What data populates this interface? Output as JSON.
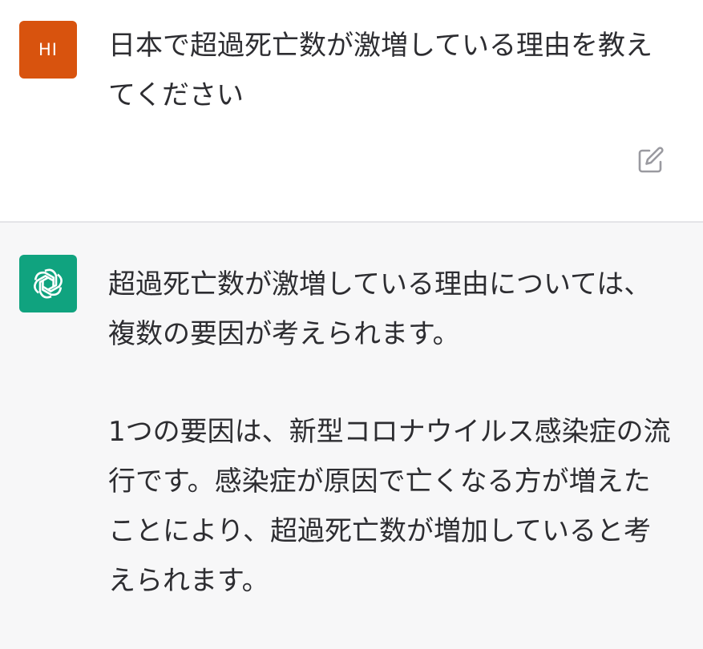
{
  "user_message": {
    "avatar_initials": "HI",
    "avatar_color": "#d8530e",
    "text": "日本で超過死亡数が激増している理由を教えてください",
    "edit_icon": "edit-icon"
  },
  "assistant_message": {
    "avatar_icon": "openai-logo-icon",
    "avatar_color": "#10a37f",
    "paragraphs": [
      "超過死亡数が激増している理由については、複数の要因が考えられます。",
      "1つの要因は、新型コロナウイルス感染症の流行です。感染症が原因で亡くなる方が増えたことにより、超過死亡数が増加していると考えられます。"
    ]
  }
}
